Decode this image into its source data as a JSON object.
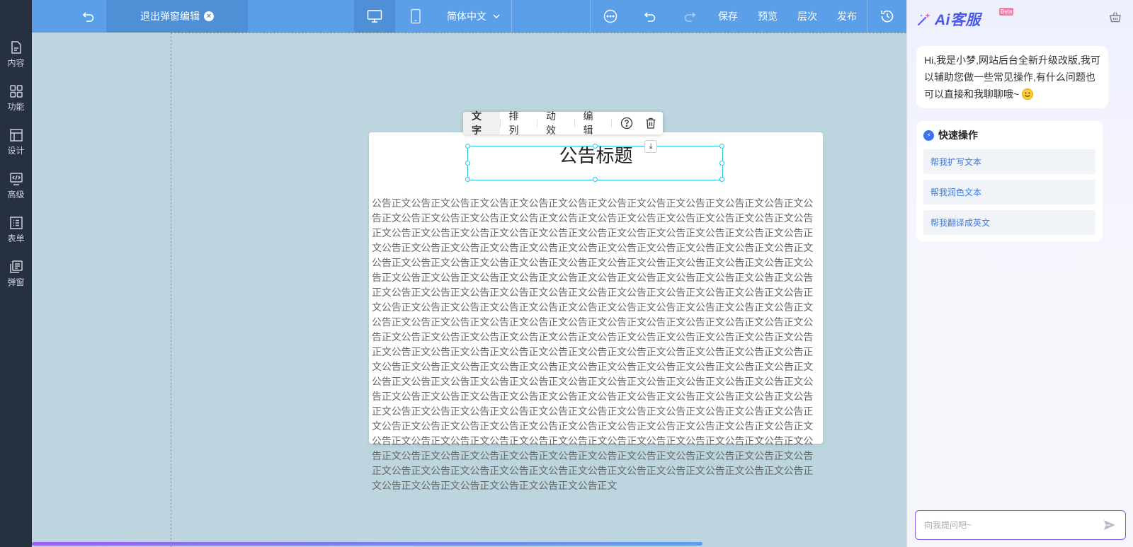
{
  "topbar": {
    "exit_label": "退出弹窗编辑",
    "language": "简体中文",
    "save": "保存",
    "preview": "预览",
    "layers": "层次",
    "publish": "发布"
  },
  "sidebar": {
    "items": [
      {
        "label": "内容",
        "icon": "file-icon"
      },
      {
        "label": "功能",
        "icon": "grid-icon"
      },
      {
        "label": "设计",
        "icon": "layout-icon"
      },
      {
        "label": "高级",
        "icon": "code-monitor-icon"
      },
      {
        "label": "表单",
        "icon": "list-icon"
      },
      {
        "label": "弹窗",
        "icon": "popup-icon"
      }
    ]
  },
  "editor_toolbar": {
    "text": "文字",
    "arrange": "排列",
    "animation": "动效",
    "edit": "编辑"
  },
  "popup": {
    "title": "公告标题",
    "body": "公告正文公告正文公告正文公告正文公告正文公告正文公告正文公告正文公告正文公告正文公告正文公告正文公告正文公告正文公告正文公告正文公告正文公告正文公告正文公告正文公告正文公告正文公告正文公告正文公告正文公告正文公告正文公告正文公告正文公告正文公告正文公告正文公告正文公告正文公告正文公告正文公告正文公告正文公告正文公告正文公告正文公告正文公告正文公告正文公告正文公告正文公告正文公告正文公告正文公告正文公告正文公告正文公告正文公告正文公告正文公告正文公告正文公告正文公告正文公告正文公告正文公告正文公告正文公告正文公告正文公告正文公告正文公告正文公告正文公告正文公告正文公告正文公告正文公告正文公告正文公告正文公告正文公告正文公告正文公告正文公告正文公告正文公告正文公告正文公告正文公告正文公告正文公告正文公告正文公告正文公告正文公告正文公告正文公告正文公告正文公告正文公告正文公告正文公告正文公告正文公告正文公告正文公告正文公告正文公告正文公告正文公告正文公告正文公告正文公告正文公告正文公告正文公告正文公告正文公告正文公告正文公告正文公告正文公告正文公告正文公告正文公告正文公告正文公告正文公告正文公告正文公告正文公告正文公告正文公告正文公告正文公告正文公告正文公告正文公告正文公告正文公告正文公告正文公告正文公告正文公告正文公告正文公告正文公告正文公告正文公告正文公告正文公告正文公告正文公告正文公告正文公告正文公告正文公告正文公告正文公告正文公告正文公告正文公告正文公告正文公告正文公告正文公告正文公告正文公告正文公告正文公告正文公告正文公告正文公告正文公告正文公告正文公告正文公告正文公告正文公告正文公告正文公告正文公告正文公告正文公告正文公告正文公告正文公告正文公告正文公告正文公告正文公告正文公告正文公告正文公告正文公告正文公告正文公告正文公告正文公告正文公告正文公告正文公告正文公告正文公告正文公告正文公告正文公告正文公告正文公告正文公告正文公告正文公告正文公告正文公告正文公告正文公告正文公告正文公告正文公告正文公告正文公告正文公告正文公告正文"
  },
  "assistant": {
    "brand": "Ai客服",
    "badge": "Beta",
    "greeting": "Hi,我是小梦,网站后台全新升级改版,我可以辅助您做一些常见操作,有什么问题也可以直接和我聊聊哦~",
    "quick_title": "快速操作",
    "quick_actions": [
      "帮我扩写文本",
      "帮我润色文本",
      "帮我翻译成英文"
    ],
    "input_placeholder": "向我提问吧~"
  },
  "colors": {
    "topbar": "#5b9fe8",
    "sidebar": "#26303f",
    "canvas": "#bcd5de",
    "selection": "#2bc6e6",
    "accent": "#4a59e8"
  }
}
